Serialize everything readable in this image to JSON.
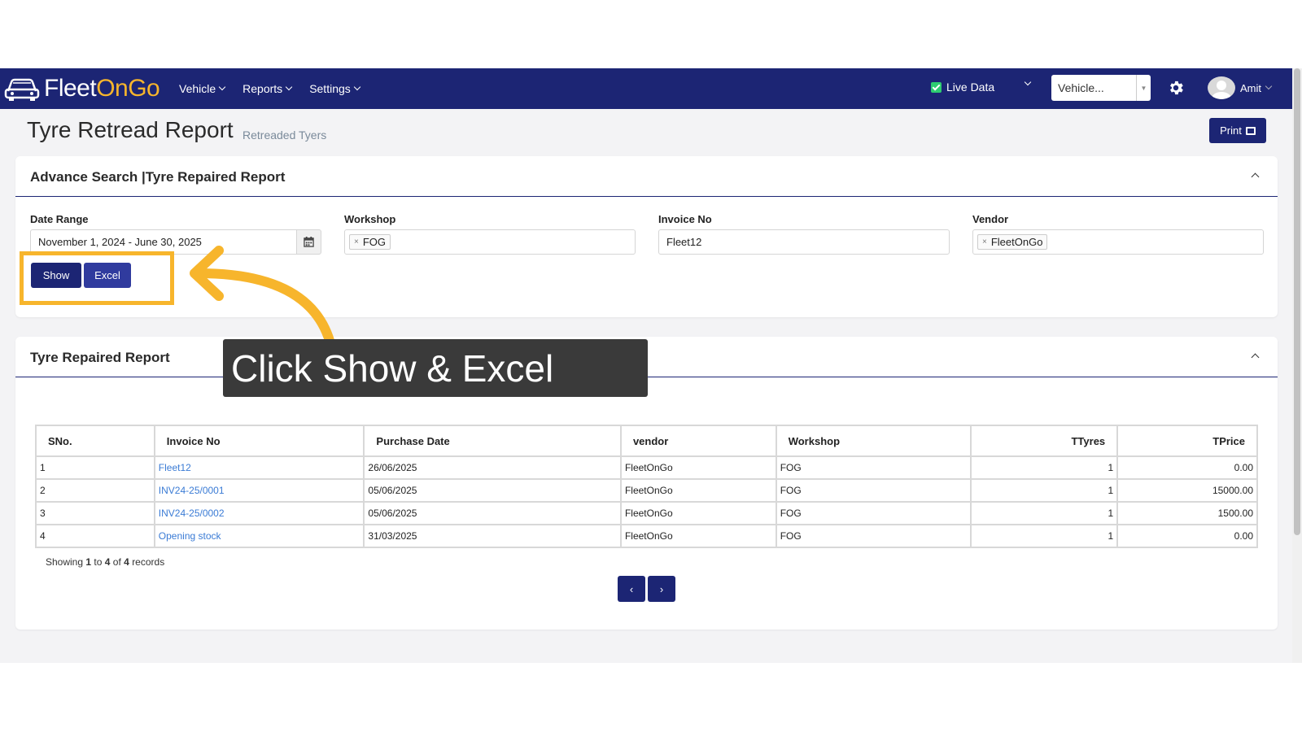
{
  "navbar": {
    "logo": {
      "part1": "Fleet",
      "part2": "OnGo"
    },
    "menu": [
      {
        "label": "Vehicle"
      },
      {
        "label": "Reports"
      },
      {
        "label": "Settings"
      }
    ],
    "live_data_label": "Live Data",
    "vehicle_select": "Vehicle...",
    "user_name": "Amit"
  },
  "page": {
    "title": "Tyre Retread Report",
    "subtitle": "Retreaded Tyers",
    "print_label": "Print"
  },
  "search": {
    "title": "Advance Search |Tyre Repaired Report",
    "date_range": {
      "label": "Date Range",
      "value": "November 1, 2024 - June 30, 2025"
    },
    "workshop": {
      "label": "Workshop",
      "tag": "FOG"
    },
    "invoice": {
      "label": "Invoice No",
      "value": "Fleet12"
    },
    "vendor": {
      "label": "Vendor",
      "tag": "FleetOnGo"
    },
    "show_label": "Show",
    "excel_label": "Excel"
  },
  "report": {
    "title": "Tyre Repaired Report",
    "columns": [
      "SNo.",
      "Invoice No",
      "Purchase Date",
      "vendor",
      "Workshop",
      "TTyres",
      "TPrice"
    ],
    "rows": [
      {
        "sno": "1",
        "invoice": "Fleet12",
        "date": "26/06/2025",
        "vendor": "FleetOnGo",
        "workshop": "FOG",
        "ttyres": "1",
        "tprice": "0.00"
      },
      {
        "sno": "2",
        "invoice": "INV24-25/0001",
        "date": "05/06/2025",
        "vendor": "FleetOnGo",
        "workshop": "FOG",
        "ttyres": "1",
        "tprice": "15000.00"
      },
      {
        "sno": "3",
        "invoice": "INV24-25/0002",
        "date": "05/06/2025",
        "vendor": "FleetOnGo",
        "workshop": "FOG",
        "ttyres": "1",
        "tprice": "1500.00"
      },
      {
        "sno": "4",
        "invoice": "Opening stock",
        "date": "31/03/2025",
        "vendor": "FleetOnGo",
        "workshop": "FOG",
        "ttyres": "1",
        "tprice": "0.00"
      }
    ],
    "showing": {
      "prefix": "Showing",
      "from": "1",
      "to_word": "to",
      "to": "4",
      "of_word": "of",
      "total": "4",
      "suffix": "records"
    },
    "prev": "‹",
    "next": "›"
  },
  "overlay": {
    "callout_text": "Click Show & Excel",
    "highlight_color": "#f7b52c"
  },
  "colors": {
    "navbar": "#1c2574",
    "accent": "#f7b52c",
    "link": "#3a7bd5"
  }
}
